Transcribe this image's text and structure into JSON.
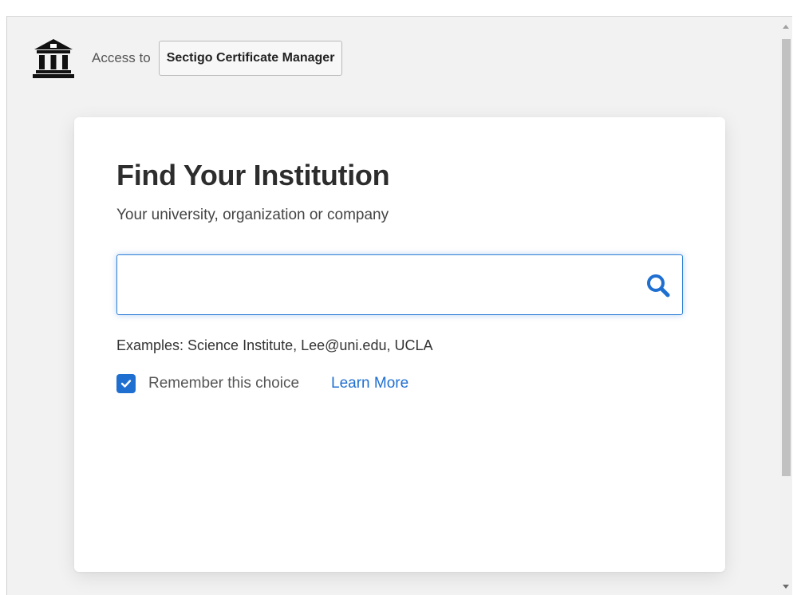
{
  "header": {
    "access_label": "Access to",
    "service_name": "Sectigo Certificate Manager",
    "icon": "institution-icon"
  },
  "card": {
    "title": "Find Your Institution",
    "subtitle": "Your university, organization or company",
    "search": {
      "value": "",
      "placeholder": "",
      "icon": "search-icon"
    },
    "examples": "Examples: Science Institute, Lee@uni.edu, UCLA",
    "remember": {
      "label": "Remember this choice",
      "checked": true
    },
    "learn_more": "Learn More"
  },
  "colors": {
    "accent": "#1f6fd1",
    "page_bg": "#f2f2f2",
    "card_bg": "#ffffff"
  }
}
